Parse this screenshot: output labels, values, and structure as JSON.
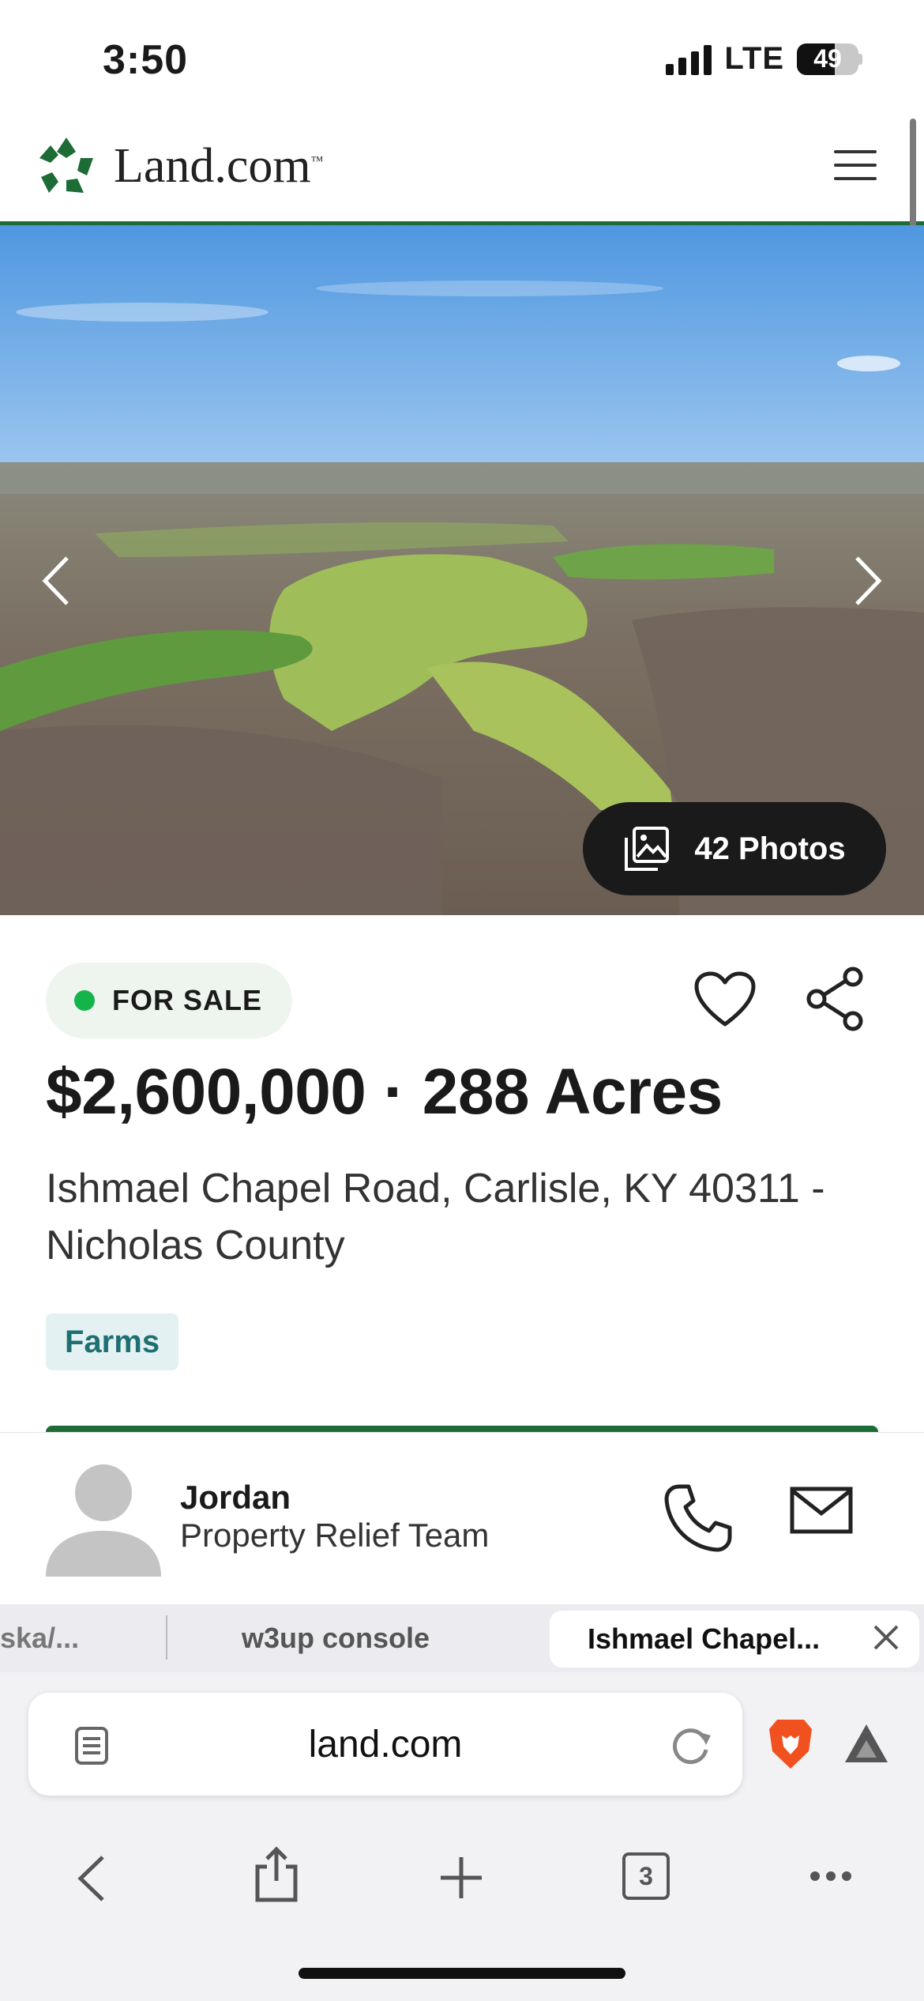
{
  "status_bar": {
    "time": "3:50",
    "network": "LTE",
    "battery": "49"
  },
  "header": {
    "logo_text": "Land.com",
    "logo_tm": "™"
  },
  "hero": {
    "photos_label": "42 Photos"
  },
  "listing": {
    "status": "FOR SALE",
    "price_line": "$2,600,000 · 288 Acres",
    "address": "Ishmael Chapel Road, Carlisle, KY 40311 - Nicholas County",
    "tag": "Farms"
  },
  "agent": {
    "name": "Jordan",
    "team": "Property Relief Team"
  },
  "tabs": [
    {
      "label": "ska/..."
    },
    {
      "label": "w3up console"
    },
    {
      "label": "Ishmael Chapel..."
    }
  ],
  "browser": {
    "url": "land.com",
    "tab_count": "3"
  },
  "colors": {
    "brand_green": "#1d6b35",
    "sale_dot": "#15b44a",
    "tag_teal": "#1f6f72"
  }
}
